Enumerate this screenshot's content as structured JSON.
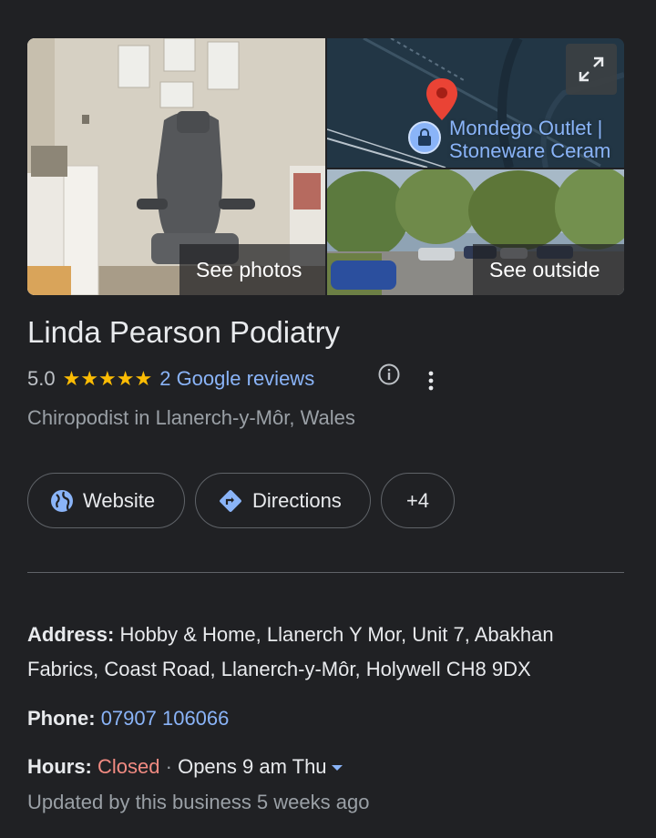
{
  "media": {
    "photos_label": "See photos",
    "outside_label": "See outside",
    "map_place_line1": "Mondego Outlet |",
    "map_place_line2": "Stoneware Ceram"
  },
  "business": {
    "name": "Linda Pearson Podiatry",
    "rating": "5.0",
    "stars": "★★★★★",
    "reviews_text": "2 Google reviews",
    "category": "Chiropodist in Llanerch-y-Môr, Wales"
  },
  "actions": {
    "website": "Website",
    "directions": "Directions",
    "more": "+4"
  },
  "details": {
    "address_label": "Address:",
    "address_value": "Hobby & Home, Llanerch Y Mor, Unit 7, Abakhan Fabrics, Coast Road, Llanerch-y-Môr, Holywell CH8 9DX",
    "phone_label": "Phone:",
    "phone_value": "07907 106066",
    "hours_label": "Hours:",
    "hours_status": "Closed",
    "hours_separator": "·",
    "hours_next": "Opens 9 am Thu",
    "updated": "Updated by this business 5 weeks ago"
  },
  "colors": {
    "background": "#202124",
    "link": "#8ab4f8",
    "star": "#fbbc04",
    "closed": "#f28b82",
    "map_pin": "#ea4335"
  },
  "icons": [
    "expand-icon",
    "map-pin-icon",
    "shopping-bag-icon",
    "star-icon",
    "info-icon",
    "more-vert-icon",
    "globe-icon",
    "directions-icon",
    "chevron-down-icon"
  ]
}
